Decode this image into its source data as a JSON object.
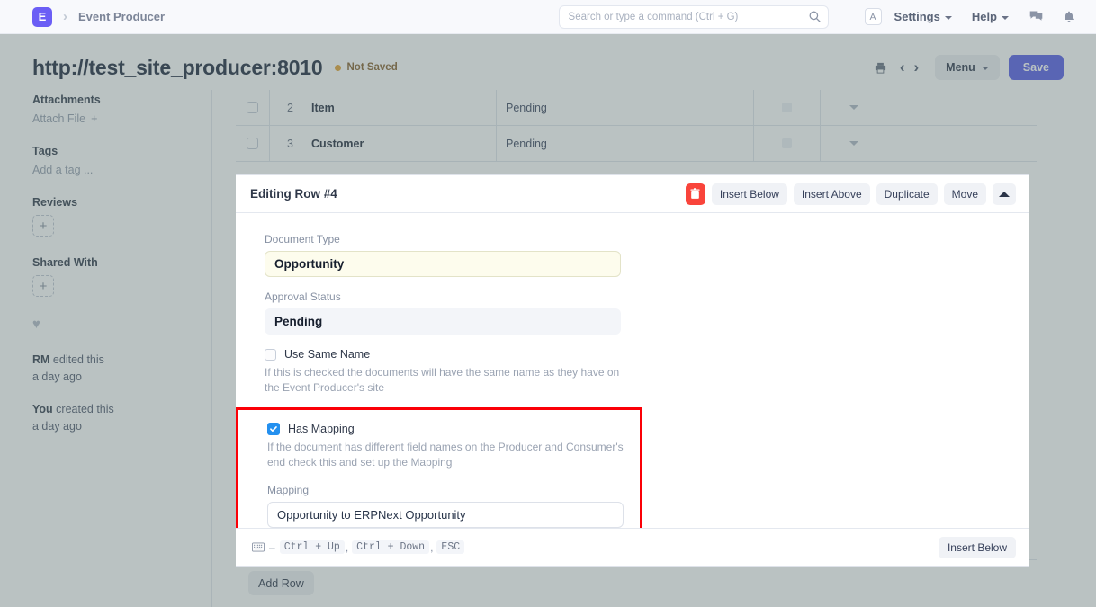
{
  "navbar": {
    "logo_letter": "E",
    "breadcrumb": "Event Producer",
    "search_placeholder": "Search or type a command (Ctrl + G)",
    "search_value": "",
    "avatar_letter": "A",
    "settings_label": "Settings",
    "help_label": "Help",
    "icons": {
      "search": "search-icon",
      "comment": "comment-icon",
      "bell": "notification-bell-icon"
    }
  },
  "page_head": {
    "title": "http://test_site_producer:8010",
    "status": "Not Saved",
    "status_color": "#e5a73e",
    "menu_label": "Menu",
    "save_label": "Save",
    "icons": {
      "print": "print-icon",
      "prev": "chevron-left-icon",
      "next": "chevron-right-icon"
    }
  },
  "sidebar": {
    "attachments_title": "Attachments",
    "attach_file_label": "Attach File",
    "tags_title": "Tags",
    "add_tag_label": "Add a tag ...",
    "reviews_title": "Reviews",
    "shared_with_title": "Shared With",
    "plus_label": "+",
    "activity": [
      {
        "actor": "RM",
        "action": " edited this",
        "time": "a day ago"
      },
      {
        "actor": "You",
        "action": " created this",
        "time": "a day ago"
      }
    ]
  },
  "grid": {
    "rows": [
      {
        "index": "2",
        "name": "Item",
        "status": "Pending"
      },
      {
        "index": "3",
        "name": "Customer",
        "status": "Pending"
      }
    ],
    "add_row_label": "Add Row"
  },
  "edit_panel": {
    "title": "Editing Row #4",
    "actions": {
      "delete": "delete-row",
      "insert_below": "Insert Below",
      "insert_above": "Insert Above",
      "duplicate": "Duplicate",
      "move": "Move",
      "collapse": "collapse"
    },
    "fields": {
      "document_type": {
        "label": "Document Type",
        "value": "Opportunity",
        "mandatory": true
      },
      "approval_status": {
        "label": "Approval Status",
        "value": "Pending",
        "readonly": true
      },
      "use_same_name": {
        "label": "Use Same Name",
        "checked": false,
        "help": "If this is checked the documents will have the same name as they have on the Event Producer's site"
      },
      "has_mapping": {
        "label": "Has Mapping",
        "checked": true,
        "help": "If the document has different field names on the Producer and Consumer's end check this and set up the Mapping"
      },
      "mapping": {
        "label": "Mapping",
        "value": "Opportunity to ERPNext Opportunity"
      }
    },
    "footer": {
      "shortcuts": [
        "Ctrl + Up",
        "Ctrl + Down",
        "ESC"
      ],
      "separator": ",",
      "dash": "–",
      "insert_below_label": "Insert Below"
    },
    "highlight_color": "#fb0007"
  }
}
